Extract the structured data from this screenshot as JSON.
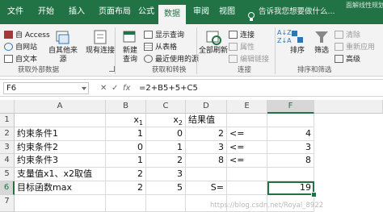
{
  "title_fragment": "面解线性规划...",
  "tabs": [
    "文件",
    "开始",
    "插入",
    "页面布局",
    "公式",
    "数据",
    "审阅",
    "视图"
  ],
  "active_tab": "数据",
  "tell_me": "告诉我您想要做什么...",
  "ribbon": {
    "get_external": {
      "access": "自 Access",
      "web": "自网站",
      "text": "自文本",
      "other": "自其他来源",
      "existing": "现有连接",
      "label": "获取外部数据"
    },
    "transform": {
      "new_query": "新建\n查询",
      "show_queries": "显示查询",
      "from_table": "从表格",
      "recent_sources": "最近使用的源",
      "label": "获取和转换"
    },
    "connections": {
      "refresh_all": "全部刷新",
      "connections": "连接",
      "properties": "属性",
      "edit_links": "编辑链接",
      "label": "连接"
    },
    "sort_filter": {
      "sort": "排序",
      "filter": "筛选",
      "clear": "清除",
      "reapply": "重新应用",
      "advanced": "高级",
      "label": "排序和筛选"
    }
  },
  "formula_bar": {
    "name_box": "F6",
    "cancel": "✕",
    "enter": "✓",
    "fx": "fx",
    "formula": "=2+B5+5+C5"
  },
  "columns": [
    "A",
    "B",
    "C",
    "D",
    "E",
    "F"
  ],
  "rows": [
    "1",
    "2",
    "3",
    "4",
    "5",
    "6",
    "7"
  ],
  "selected_cell": "F6",
  "cells": {
    "B1": "x1",
    "C1": "x2",
    "D1": "结果值",
    "A2": "约束条件1",
    "B2": "1",
    "C2": "0",
    "D2": "2",
    "E2": "<=",
    "F2": "4",
    "A3": "约束条件2",
    "B3": "0",
    "C3": "1",
    "D3": "3",
    "E3": "<=",
    "F3": "3",
    "A4": "约束条件3",
    "B4": "1",
    "C4": "2",
    "D4": "8",
    "E4": "<=",
    "F4": "8",
    "A5": "支量值x1、x2取值",
    "B5": "2",
    "C5": "3",
    "A6": "目标函数max",
    "B6": "2",
    "C6": "5",
    "D6": "S=",
    "F6": "19"
  },
  "watermark": "https://blog.csdn.net/Royal_8922"
}
